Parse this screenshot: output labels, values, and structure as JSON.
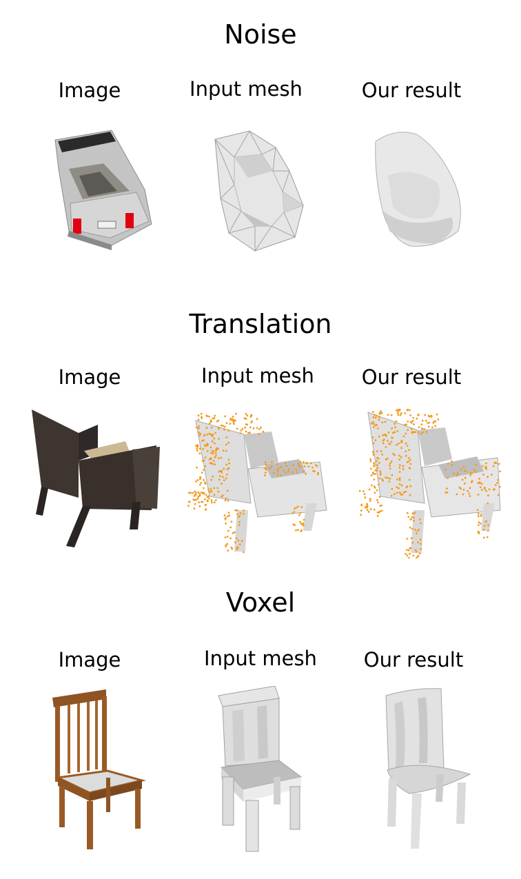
{
  "sections": [
    {
      "title": "Noise",
      "labels": [
        "Image",
        "Input mesh",
        "Our result"
      ],
      "subjects": [
        "car-image",
        "car-noisy-mesh",
        "car-result-mesh"
      ]
    },
    {
      "title": "Translation",
      "labels": [
        "Image",
        "Input mesh",
        "Our result"
      ],
      "subjects": [
        "armchair-image",
        "armchair-input-mesh",
        "armchair-result-mesh"
      ]
    },
    {
      "title": "Voxel",
      "labels": [
        "Image",
        "Input mesh",
        "Our result"
      ],
      "subjects": [
        "wooden-chair-image",
        "chair-voxel-mesh",
        "chair-result-mesh"
      ]
    }
  ],
  "colors": {
    "mesh_gray": "#d9d9d9",
    "mesh_shadow": "#a9a9a9",
    "points_orange": "#f39a1e",
    "chair_wood": "#9a5a25",
    "wicker_dark": "#3b322d",
    "car_body": "#b8b8b8",
    "tail_light": "#e00010"
  }
}
